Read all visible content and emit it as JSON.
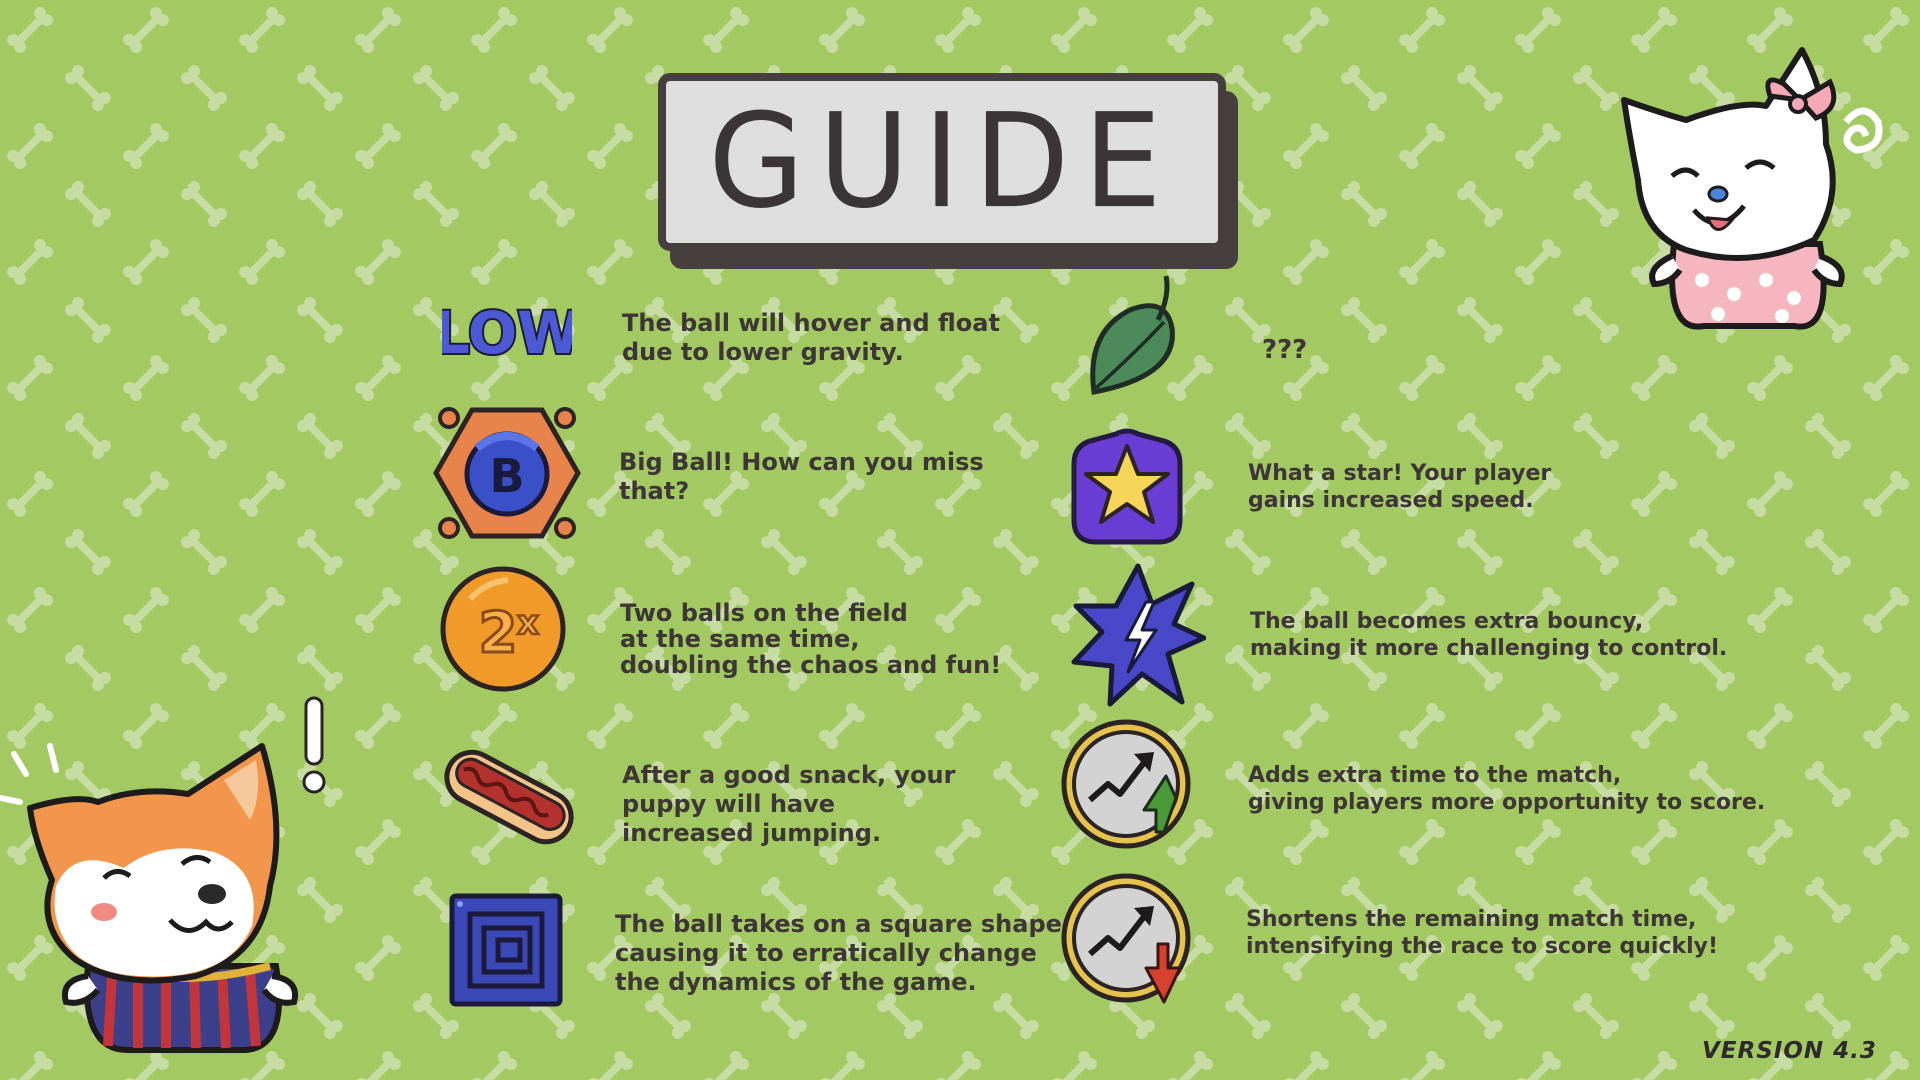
{
  "title": "GUIDE",
  "version": "VERSION 4.3",
  "colors": {
    "background": "#a3c962",
    "bone_pattern": "#c6dca2",
    "title_box": "#dedede",
    "title_border": "#463e3f",
    "text": "#3e3536"
  },
  "left_items": [
    {
      "icon": "low-gravity-icon",
      "description": "The ball will hover and float\ndue to lower gravity."
    },
    {
      "icon": "big-ball-icon",
      "description": "Big Ball! How can you miss\nthat?"
    },
    {
      "icon": "double-ball-icon",
      "description": "Two balls on the field\nat the same time,\ndoubling the chaos and fun!"
    },
    {
      "icon": "hotdog-icon",
      "description": "After a good snack, your\npuppy will have\nincreased jumping."
    },
    {
      "icon": "square-ball-icon",
      "description": "The ball takes on a square shape,\ncausing it to erratically change\n the dynamics of the game."
    }
  ],
  "right_items": [
    {
      "icon": "leaf-icon",
      "description": "???"
    },
    {
      "icon": "star-icon",
      "description": "What a star! Your player\ngains increased speed."
    },
    {
      "icon": "lightning-burst-icon",
      "description": "The ball becomes extra bouncy,\nmaking it more challenging to control."
    },
    {
      "icon": "clock-plus-icon",
      "description": "Adds extra time to the match,\ngiving players more opportunity to score."
    },
    {
      "icon": "clock-minus-icon",
      "description": "Shortens the remaining match time,\nintensifying the race to score quickly!"
    }
  ],
  "characters": [
    "white-cat-character",
    "shiba-dog-character"
  ]
}
